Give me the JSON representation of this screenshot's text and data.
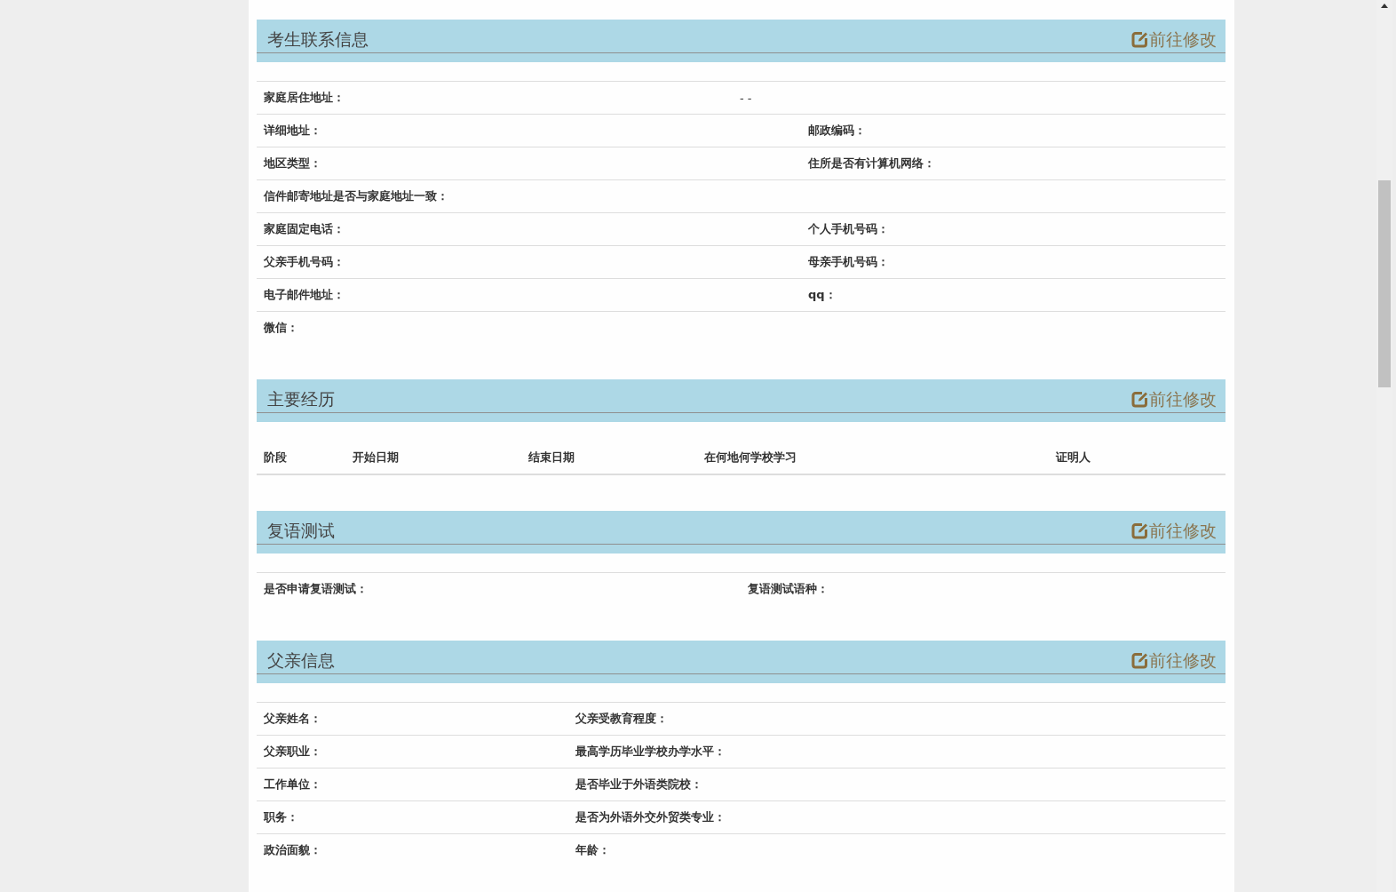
{
  "sections": [
    {
      "kind": "fields",
      "title": "考生联系信息",
      "edit_label": "前往修改",
      "rows": [
        {
          "pairs": [
            {
              "label": "家庭居住地址：",
              "value": "- -"
            }
          ]
        },
        {
          "pairs": [
            {
              "label": "详细地址："
            },
            {
              "label": "邮政编码："
            }
          ]
        },
        {
          "pairs": [
            {
              "label": "地区类型："
            },
            {
              "label": "住所是否有计算机网络："
            }
          ]
        },
        {
          "pairs": [
            {
              "label": "信件邮寄地址是否与家庭地址一致："
            }
          ]
        },
        {
          "pairs": [
            {
              "label": "家庭固定电话："
            },
            {
              "label": "个人手机号码："
            }
          ]
        },
        {
          "pairs": [
            {
              "label": "父亲手机号码："
            },
            {
              "label": "母亲手机号码："
            }
          ]
        },
        {
          "pairs": [
            {
              "label": "电子邮件地址："
            },
            {
              "label": "qq："
            }
          ]
        },
        {
          "pairs": [
            {
              "label": "微信："
            }
          ]
        }
      ]
    },
    {
      "kind": "table",
      "title": "主要经历",
      "edit_label": "前往修改",
      "columns": [
        "阶段",
        "开始日期",
        "结束日期",
        "在何地何学校学习",
        "证明人"
      ]
    },
    {
      "kind": "fields",
      "title": "复语测试",
      "edit_label": "前往修改",
      "rows": [
        {
          "pairs": [
            {
              "label": "是否申请复语测试："
            },
            {
              "label": "复语测试语种："
            }
          ]
        }
      ]
    },
    {
      "kind": "fields",
      "title": "父亲信息",
      "edit_label": "前往修改",
      "rows": [
        {
          "pairs": [
            {
              "label": "父亲姓名："
            },
            {
              "label": "父亲受教育程度："
            }
          ]
        },
        {
          "pairs": [
            {
              "label": "父亲职业："
            },
            {
              "label": "最高学历毕业学校办学水平："
            }
          ]
        },
        {
          "pairs": [
            {
              "label": "工作单位："
            },
            {
              "label": "是否毕业于外语类院校："
            }
          ]
        },
        {
          "pairs": [
            {
              "label": "职务："
            },
            {
              "label": "是否为外语外交外贸类专业："
            }
          ]
        },
        {
          "pairs": [
            {
              "label": "政治面貌："
            },
            {
              "label": "年龄："
            }
          ]
        }
      ]
    }
  ]
}
